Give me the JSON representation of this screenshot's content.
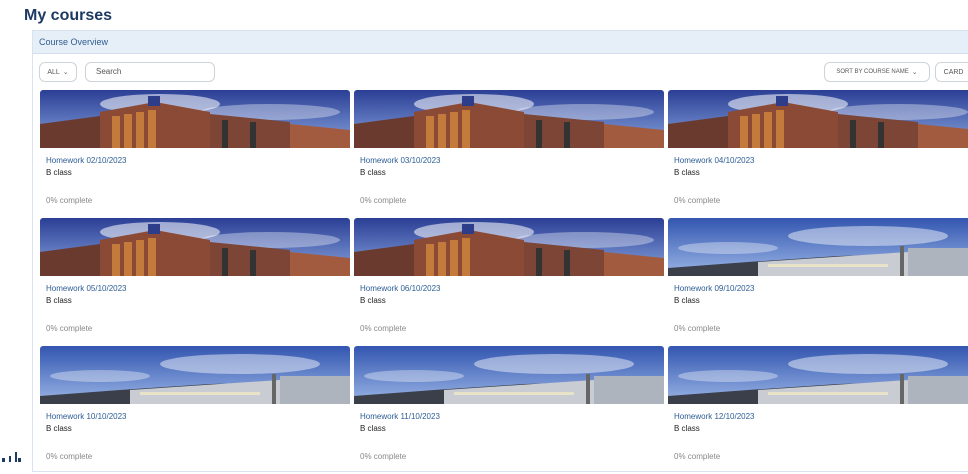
{
  "page_title": "My courses",
  "panel": {
    "header": "Course Overview",
    "filter_label": "ALL",
    "search_placeholder": "Search",
    "sort_label": "SORT BY COURSE NAME",
    "view_label": "CARD"
  },
  "courses": [
    {
      "title": "Homework 02/10/2023",
      "subtitle": "B class",
      "progress": "0% complete",
      "image": "brick-building"
    },
    {
      "title": "Homework 03/10/2023",
      "subtitle": "B class",
      "progress": "0% complete",
      "image": "brick-building"
    },
    {
      "title": "Homework 04/10/2023",
      "subtitle": "B class",
      "progress": "0% complete",
      "image": "brick-building"
    },
    {
      "title": "Homework 05/10/2023",
      "subtitle": "B class",
      "progress": "0% complete",
      "image": "brick-building"
    },
    {
      "title": "Homework 06/10/2023",
      "subtitle": "B class",
      "progress": "0% complete",
      "image": "brick-building"
    },
    {
      "title": "Homework 09/10/2023",
      "subtitle": "B class",
      "progress": "0% complete",
      "image": "modern-building"
    },
    {
      "title": "Homework 10/10/2023",
      "subtitle": "B class",
      "progress": "0% complete",
      "image": "modern-building"
    },
    {
      "title": "Homework 11/10/2023",
      "subtitle": "B class",
      "progress": "0% complete",
      "image": "modern-building"
    },
    {
      "title": "Homework 12/10/2023",
      "subtitle": "B class",
      "progress": "0% complete",
      "image": "modern-building"
    }
  ],
  "colors": {
    "title": "#1d3a63",
    "link": "#2d5d94",
    "sky": "#2f4fa8",
    "header_bg": "#e6eef8"
  }
}
